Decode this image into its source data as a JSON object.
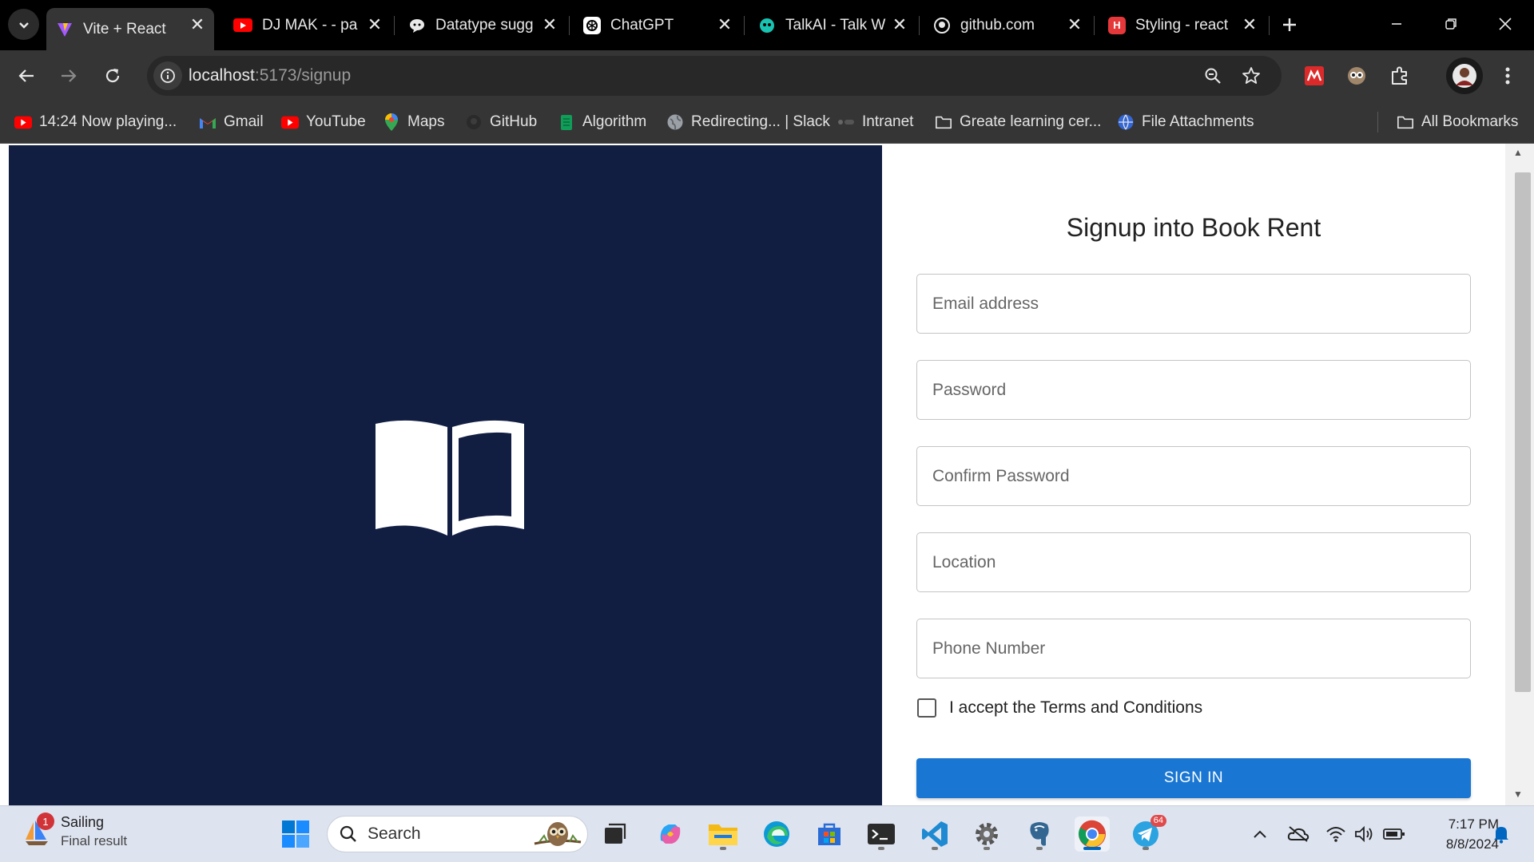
{
  "browser": {
    "tabs": [
      {
        "title": "Vite + React",
        "active": true
      },
      {
        "title": "DJ MAK - - pa",
        "active": false
      },
      {
        "title": "Datatype sugg",
        "active": false
      },
      {
        "title": "ChatGPT",
        "active": false
      },
      {
        "title": "TalkAI - Talk W",
        "active": false
      },
      {
        "title": "github.com",
        "active": false
      },
      {
        "title": "Styling - react",
        "active": false
      }
    ],
    "url_host": "localhost",
    "url_path": ":5173/signup",
    "bookmarks": [
      {
        "label": "14:24 Now playing...",
        "icon": "youtube-icon"
      },
      {
        "label": "Gmail",
        "icon": "gmail-icon"
      },
      {
        "label": "YouTube",
        "icon": "youtube-icon"
      },
      {
        "label": "Maps",
        "icon": "maps-icon"
      },
      {
        "label": "GitHub",
        "icon": "github-icon"
      },
      {
        "label": "Algorithm",
        "icon": "algorithm-icon"
      },
      {
        "label": "Redirecting... | Slack",
        "icon": "globe-icon"
      },
      {
        "label": "Intranet",
        "icon": "intranet-icon"
      },
      {
        "label": "Greate learning cer...",
        "icon": "folder-icon"
      },
      {
        "label": "File Attachments",
        "icon": "globe-icon"
      }
    ],
    "all_bookmarks_label": "All Bookmarks"
  },
  "page": {
    "title": "Signup into Book Rent",
    "fields": {
      "email_placeholder": "Email address",
      "password_placeholder": "Password",
      "confirm_password_placeholder": "Confirm Password",
      "location_placeholder": "Location",
      "phone_placeholder": "Phone Number"
    },
    "terms_label": "I accept the Terms and Conditions",
    "submit_label": "SIGN IN",
    "hero_color": "#111e42",
    "accent_color": "#1976d2"
  },
  "taskbar": {
    "weather_title": "Sailing",
    "weather_subtitle": "Final result",
    "weather_badge": "1",
    "search_label": "Search",
    "telegram_badge": "64",
    "time": "7:17 PM",
    "date": "8/8/2024"
  }
}
